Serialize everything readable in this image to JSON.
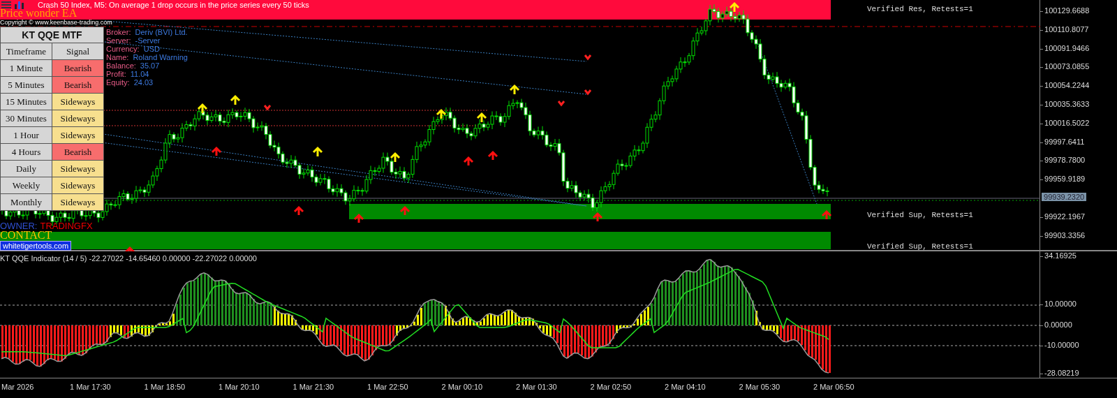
{
  "title": "Crash 50 Index, M5:  On average 1 drop occurs in the price series every 50 ticks",
  "ea_name": "Price wonder EA",
  "copyright": "Copyright © www.keenbase-trading.com",
  "account": [
    {
      "label": "Broker:",
      "value": "Deriv (BVI) Ltd."
    },
    {
      "label": "Server:",
      "value": "-Server"
    },
    {
      "label": "Currency:",
      "value": "USD"
    },
    {
      "label": "Name:",
      "value": "Roland Warning"
    },
    {
      "label": "Balance:",
      "value": "35.07"
    },
    {
      "label": "Profit:",
      "value": "11.04"
    },
    {
      "label": "Equity:",
      "value": "24.03"
    }
  ],
  "mtf_table": {
    "title": "KT QQE MTF",
    "columns": [
      "Timeframe",
      "Signal"
    ],
    "rows": [
      {
        "timeframe": "1 Minute",
        "signal": "Bearish",
        "kind": "bearish"
      },
      {
        "timeframe": "5 Minutes",
        "signal": "Bearish",
        "kind": "bearish"
      },
      {
        "timeframe": "15 Minutes",
        "signal": "Sideways",
        "kind": "sideways"
      },
      {
        "timeframe": "30 Minutes",
        "signal": "Sideways",
        "kind": "sideways"
      },
      {
        "timeframe": "1 Hour",
        "signal": "Sideways",
        "kind": "sideways"
      },
      {
        "timeframe": "4 Hours",
        "signal": "Bearish",
        "kind": "bearish"
      },
      {
        "timeframe": "Daily",
        "signal": "Sideways",
        "kind": "sideways"
      },
      {
        "timeframe": "Weekly",
        "signal": "Sideways",
        "kind": "sideways"
      },
      {
        "timeframe": "Monthly",
        "signal": "Sideways",
        "kind": "sideways"
      }
    ]
  },
  "owner": {
    "label": "OWNER:",
    "value": "TRADINGFX"
  },
  "contact": "CONTACT",
  "website": "whitetigertools.com",
  "zones": [
    {
      "label": "Verified Res, Retests=1",
      "kind": "resistance"
    },
    {
      "label": "Verified Sup, Retests=1",
      "kind": "support"
    },
    {
      "label": "Verified Sup, Retests=1",
      "kind": "support"
    }
  ],
  "price_axis": [
    "100129.6688",
    "100110.8077",
    "100091.9466",
    "100073.0855",
    "100054.2244",
    "100035.3633",
    "100016.5022",
    "99997.6411",
    "99978.7800",
    "99959.9189"
  ],
  "current_price": "99939.2320",
  "price_axis_lower": [
    "99922.1967",
    "99903.3356"
  ],
  "indicator": {
    "label": "KT QQE Indicator (14 / 5) -22.27022 -14.65460 0.00000 -22.27022 0.00000",
    "axis": [
      "34.16925",
      "10.00000",
      "0.00000",
      "-10.00000",
      "-28.08219"
    ]
  },
  "time_axis": [
    "Mar 2026",
    "1 Mar 17:30",
    "1 Mar 18:50",
    "1 Mar 20:10",
    "1 Mar 21:30",
    "1 Mar 22:50",
    "2 Mar 00:10",
    "2 Mar 01:30",
    "2 Mar 02:50",
    "2 Mar 04:10",
    "2 Mar 05:30",
    "2 Mar 06:50"
  ]
}
